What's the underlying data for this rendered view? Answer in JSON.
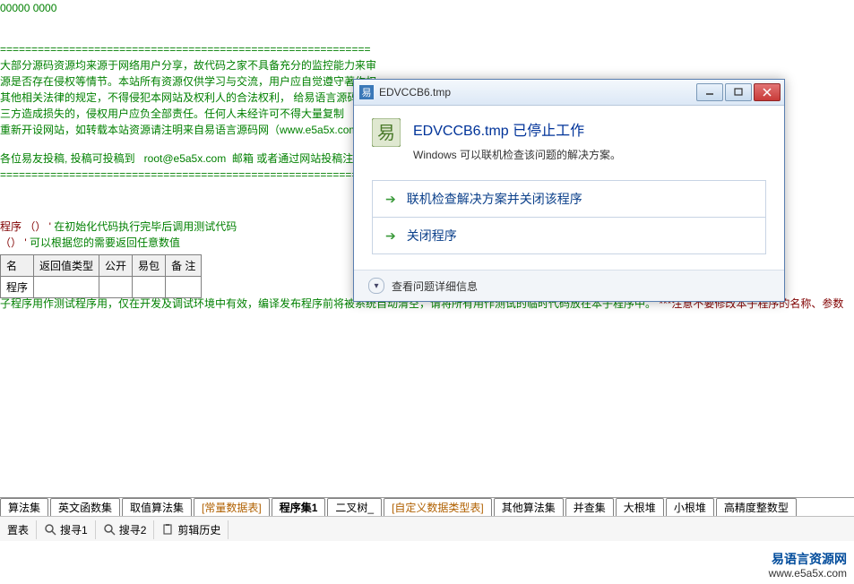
{
  "code": {
    "hex_line": "00000 0000",
    "sep": "===========================================================",
    "terms": [
      "大部分源码资源均来源于网络用户分享，故代码之家不具备充分的监控能力来审",
      "源是否存在侵权等情节。本站所有资源仅供学习与交流，用户应自觉遵守著作权",
      "其他相关法律的规定，不得侵犯本网站及权利人的合法权利， 给易语言源码",
      "三方造成损失的，侵权用户应负全部责任。任何人未经许可不得大量复制",
      "重新开设网站，如转载本站资源请注明来自易语言源码网（www.e5a5x.com）",
      "各位易友投稿, 投稿可投稿到   root@e5a5x.com  邮箱 或者通过网站投稿注"
    ],
    "mid_l1_a": "程序 （） ' ",
    "mid_l1_b": "在初始化代码执行完毕后调用测试代码",
    "mid_l2_a": "（） ' ",
    "mid_l2_b": "可以根据您的需要返回任意数值",
    "note_a": "子程序用作测试程序用，仅在开发及调试环境中有效，编译发布程序前将被系统自动清空，请将所有用作测试的临时代码放在本子程序中。  ",
    "note_b": "***注意不要修改本子程序的名称、参数"
  },
  "table": {
    "headers": [
      "名",
      "返回值类型",
      "公开",
      "易包",
      "备 注"
    ],
    "row1": "程序"
  },
  "tabs": {
    "t0": "算法集",
    "t1": "英文函数集",
    "t2": "取值算法集",
    "t3": "[常量数据表]",
    "t4": "程序集1",
    "t5": "二叉树_",
    "t6": "[自定义数据类型表]",
    "t7": "其他算法集",
    "t8": "并查集",
    "t9": "大根堆",
    "t10": "小根堆",
    "t11": "高精度整数型"
  },
  "searchbar": {
    "b0": "置表",
    "b1": "搜寻1",
    "b2": "搜寻2",
    "b3": "剪辑历史"
  },
  "watermark": {
    "name": "易语言资源网",
    "url": "www.e5a5x.com"
  },
  "dialog": {
    "title": "EDVCCB6.tmp",
    "heading": "EDVCCB6.tmp 已停止工作",
    "sub": "Windows 可以联机检查该问题的解决方案。",
    "opt1": "联机检查解决方案并关闭该程序",
    "opt2": "关闭程序",
    "details": "查看问题详细信息"
  }
}
